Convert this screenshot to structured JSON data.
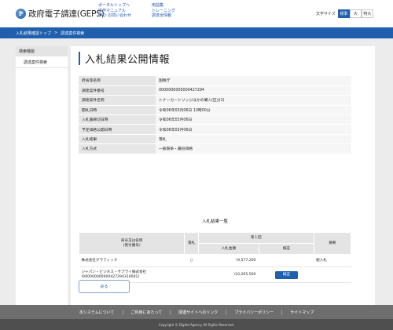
{
  "header": {
    "logo_mark": "P",
    "site_title": "政府電子調達(GEPS)",
    "nav_col1": [
      "ポータルトップへ",
      "操作マニュアル",
      "FAQ･お問い合わせ"
    ],
    "nav_col2": [
      "用語集",
      "トレーニング",
      "調達全情報"
    ],
    "font_size_label": "文字サイズ",
    "font_sizes": [
      "標準",
      "大",
      "特大"
    ],
    "font_size_selected": "標準",
    "accent_color": "#1f5fae"
  },
  "breadcrumb": {
    "items": [
      "入札結果確認トップ",
      "調達案件検索"
    ],
    "separator": ">"
  },
  "sidebar": {
    "heading": "検索機能",
    "items": [
      "調達案件検索"
    ]
  },
  "main": {
    "page_title": "入札結果公開情報",
    "info_rows": [
      {
        "label": "府省等名称",
        "value": "国税庁"
      },
      {
        "label": "調達案件番号",
        "value": "0000000000000427294"
      },
      {
        "label": "調達案件名称",
        "value": "トナーカートリッジほかの購入(区分1)"
      },
      {
        "label": "開札日時",
        "value": "令和06年03月06日 13時00分"
      },
      {
        "label": "入札書締切日時",
        "value": "令和06年03月06日"
      },
      {
        "label": "予定価格公開日時",
        "value": "令和06年03月06日"
      },
      {
        "label": "入札結果",
        "value": "落札"
      },
      {
        "label": "入札方式",
        "value": "一般競争・最低価格"
      }
    ],
    "results_caption": "入札結果一覧",
    "results_table": {
      "header_company": "商号又は名称\n(受付番号)",
      "header_award": "落札",
      "header_round": "第１回",
      "header_amount": "入札金額",
      "header_check": "検証",
      "header_note": "摘要",
      "rows": [
        {
          "company": "株式会社グラフィック",
          "award": "○",
          "amount": "\\9,577,200",
          "check": "",
          "note": "組入札"
        },
        {
          "company": "ジャパン・ビジネス・サプライ株式会社\n(000000000000427294310001)",
          "award": "",
          "amount": "\\10,265,500",
          "check": "検証",
          "note": ""
        }
      ]
    },
    "back_button": "戻る"
  },
  "footer": {
    "links": [
      "本システムについて",
      "ご利用にあたって",
      "関連サイトへのリンク",
      "プライバシーポリシー",
      "サイトマップ"
    ],
    "copyright": "Copyright © Digital Agency All Rights Reserved."
  }
}
